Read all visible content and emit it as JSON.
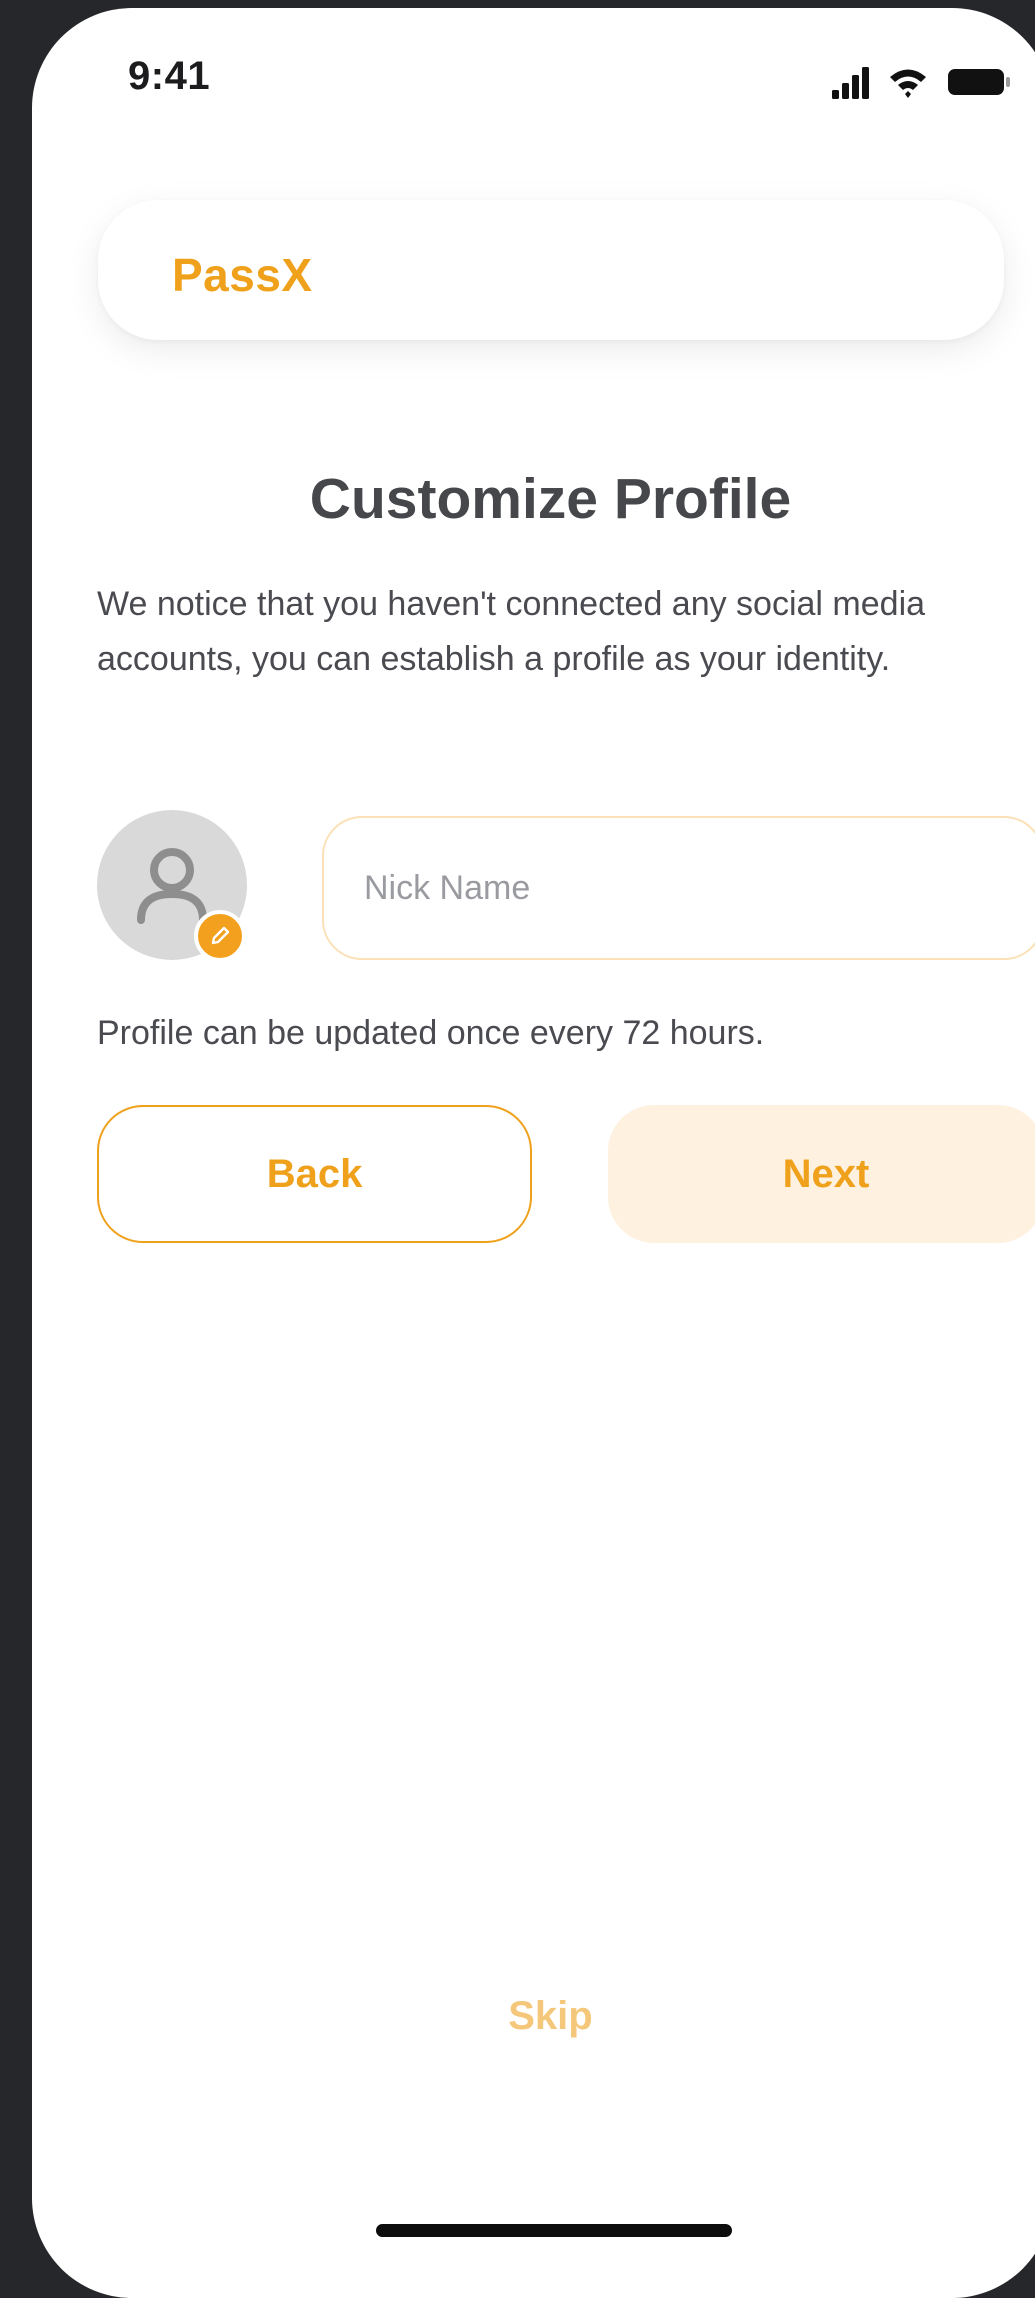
{
  "status_bar": {
    "time": "9:41",
    "icons": [
      "signal-icon",
      "wifi-icon",
      "battery-icon"
    ]
  },
  "brand": {
    "name": "PassX"
  },
  "page": {
    "title": "Customize Profile",
    "description": "We notice that you haven't connected any social media accounts, you can establish a profile as your identity."
  },
  "profile": {
    "avatar_icon": "person-icon",
    "edit_icon": "pencil-icon",
    "nickname": {
      "value": "",
      "placeholder": "Nick Name"
    },
    "hint": "Profile can be updated once every 72 hours."
  },
  "actions": {
    "back_label": "Back",
    "next_label": "Next",
    "skip_label": "Skip"
  },
  "colors": {
    "accent": "#f0a11b",
    "accent_soft": "#fff1e0",
    "input_border": "#fbe1b6",
    "title": "#46474b",
    "body_text": "#4a4b50"
  }
}
